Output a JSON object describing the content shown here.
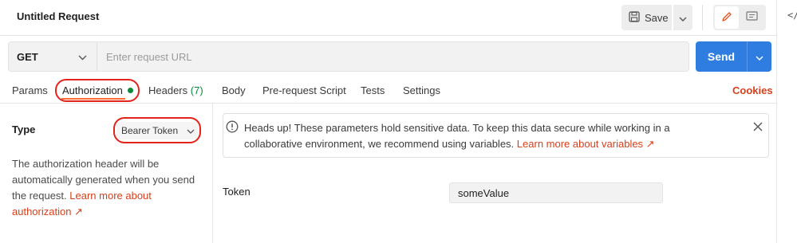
{
  "header": {
    "title": "Untitled Request",
    "save_label": "Save",
    "code_icon_text": "</"
  },
  "request": {
    "method": "GET",
    "url_placeholder": "Enter request URL",
    "url_value": "",
    "send_label": "Send"
  },
  "tabs": [
    {
      "label": "Params"
    },
    {
      "label": "Authorization"
    },
    {
      "label": "Headers",
      "count": "(7)"
    },
    {
      "label": "Body"
    },
    {
      "label": "Pre-request Script"
    },
    {
      "label": "Tests"
    },
    {
      "label": "Settings"
    }
  ],
  "active_tab": "Authorization",
  "cookies_label": "Cookies",
  "auth": {
    "type_label": "Type",
    "type_value": "Bearer Token",
    "description": "The authorization header will be automatically generated when you send the request.",
    "learn_more": "Learn more about authorization ↗"
  },
  "alert": {
    "text": "Heads up! These parameters hold sensitive data. To keep this data secure while working in a collaborative environment, we recommend using variables.",
    "link": "Learn more about variables ↗"
  },
  "token": {
    "label": "Token",
    "value": "someValue"
  },
  "colors": {
    "accent": "#ff6c37",
    "send_blue": "#2f7de1",
    "link": "#d7401c",
    "highlight_oval": "#e2231a",
    "success_green": "#0c8a3c"
  }
}
